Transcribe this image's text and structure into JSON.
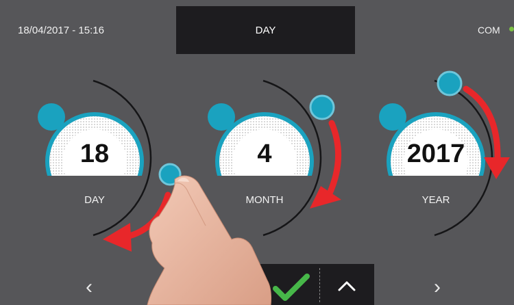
{
  "header": {
    "datetime": "18/04/2017 - 15:16",
    "title": "DAY",
    "com_label": "COM"
  },
  "dials": [
    {
      "value": "18",
      "label": "DAY"
    },
    {
      "value": "4",
      "label": "MONTH"
    },
    {
      "value": "2017",
      "label": "YEAR"
    }
  ],
  "footer": {
    "prev_label": "‹",
    "next_label": "›"
  },
  "icons": {
    "confirm": "check-icon",
    "up": "chevron-up-icon",
    "swipe": "curved-arrow-icon"
  },
  "colors": {
    "background": "#565659",
    "panel": "#1d1c1f",
    "accent": "#1aa2bf",
    "arrow": "#e8272a",
    "confirm": "#47b749",
    "status": "#7bc043"
  }
}
